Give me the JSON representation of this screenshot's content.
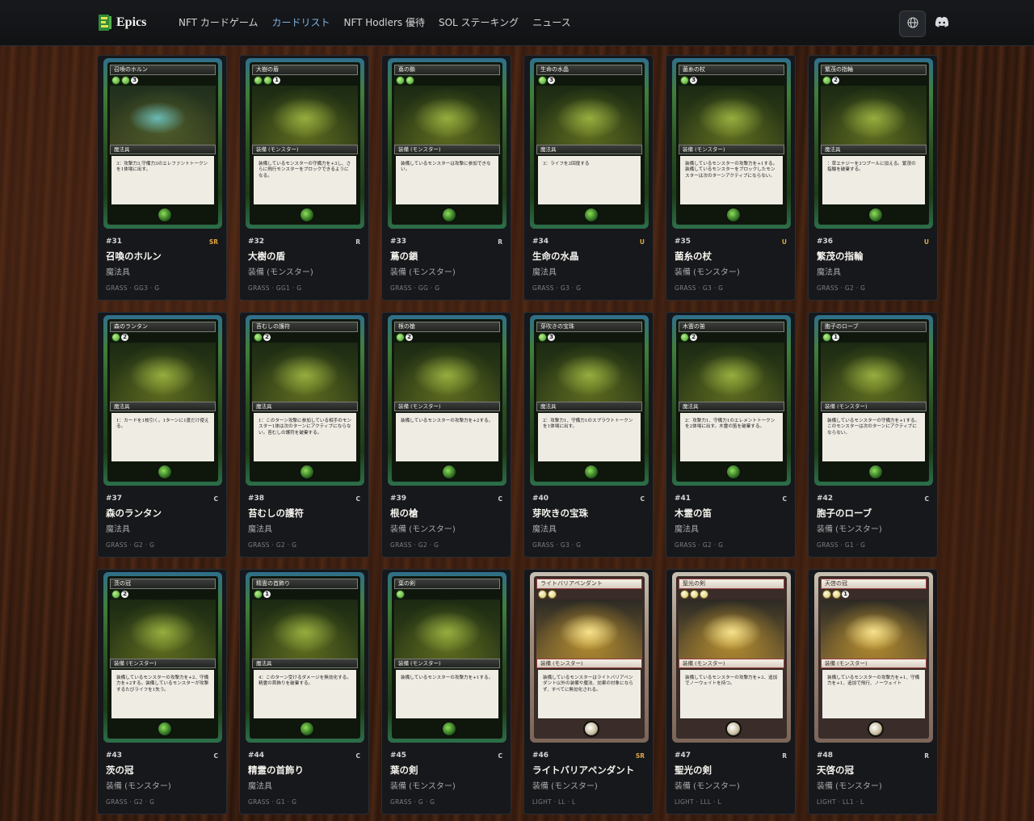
{
  "header": {
    "brand": "Epics",
    "nav": [
      {
        "label": "NFT カードゲーム",
        "active": false
      },
      {
        "label": "カードリスト",
        "active": true
      },
      {
        "label": "NFT Hodlers 優待",
        "active": false
      },
      {
        "label": "SOL ステーキング",
        "active": false
      },
      {
        "label": "ニュース",
        "active": false
      }
    ],
    "icons": {
      "language": "globe-icon",
      "discord": "discord-icon"
    }
  },
  "colors": {
    "accent": "#7fb3e6",
    "rarity_highlight": "#e0a640",
    "card_bg": "#16181b"
  },
  "cards": [
    {
      "number": "#31",
      "rarity": "SR",
      "name": "召喚のホルン",
      "type": "魔法具",
      "stats": "GRASS · GG3 · G",
      "art_title": "召喚のホルン",
      "art_type": "魔法具",
      "art_text": "3：攻撃力3,守備力3のエレファントトークンを1体場に出す。",
      "gems": 2,
      "cost": "3",
      "theme": "grass",
      "pic": "blue"
    },
    {
      "number": "#32",
      "rarity": "R",
      "name": "大樹の盾",
      "type": "装備 (モンスター)",
      "stats": "GRASS · GG1 · G",
      "art_title": "大樹の盾",
      "art_type": "装備 (モンスター)",
      "art_text": "装備しているモンスターの守備力を+3し、さらに飛行モンスターをブロックできるようになる。",
      "gems": 2,
      "cost": "1",
      "theme": "grass",
      "pic": "green"
    },
    {
      "number": "#33",
      "rarity": "R",
      "name": "蔦の鎖",
      "type": "装備 (モンスター)",
      "stats": "GRASS · GG · G",
      "art_title": "蔦の鎖",
      "art_type": "装備 (モンスター)",
      "art_text": "装備しているモンスターは攻撃に参加できない。",
      "gems": 2,
      "cost": "",
      "theme": "grass",
      "pic": "green"
    },
    {
      "number": "#34",
      "rarity": "U",
      "name": "生命の水晶",
      "type": "魔法具",
      "stats": "GRASS · G3 · G",
      "art_title": "生命の水晶",
      "art_type": "魔法具",
      "art_text": "3：ライフを2回復する",
      "gems": 1,
      "cost": "3",
      "theme": "grass",
      "pic": "green"
    },
    {
      "number": "#35",
      "rarity": "U",
      "name": "菌糸の杖",
      "type": "装備 (モンスター)",
      "stats": "GRASS · G3 · G",
      "art_title": "菌糸の杖",
      "art_type": "装備 (モンスター)",
      "art_text": "装備しているモンスターの攻撃力を+1する。装備しているモンスターをブロックしたモンスターは次のターンアクティブにならない。",
      "gems": 1,
      "cost": "3",
      "theme": "grass",
      "pic": "green"
    },
    {
      "number": "#36",
      "rarity": "U",
      "name": "繁茂の指輪",
      "type": "魔法具",
      "stats": "GRASS · G2 · G",
      "art_title": "繁茂の指輪",
      "art_type": "魔法具",
      "art_text": "：草エナジーを3つプールに加える。繁茂の指輪を破棄する。",
      "gems": 1,
      "cost": "2",
      "theme": "grass",
      "pic": "green"
    },
    {
      "number": "#37",
      "rarity": "C",
      "name": "森のランタン",
      "type": "魔法具",
      "stats": "GRASS · G2 · G",
      "art_title": "森のランタン",
      "art_type": "魔法具",
      "art_text": "1：カードを1枚引く。1ターンに1度だけ使える。",
      "gems": 1,
      "cost": "2",
      "theme": "grass",
      "pic": "green"
    },
    {
      "number": "#38",
      "rarity": "C",
      "name": "苔むしの護符",
      "type": "魔法具",
      "stats": "GRASS · G2 · G",
      "art_title": "苔むしの護符",
      "art_type": "魔法具",
      "art_text": "1：このターン攻撃に参加している相手のモンスター1体は次のターンにアクティブにならない。苔むしの護符を破棄する。",
      "gems": 1,
      "cost": "2",
      "theme": "grass",
      "pic": "green"
    },
    {
      "number": "#39",
      "rarity": "C",
      "name": "根の槍",
      "type": "装備 (モンスター)",
      "stats": "GRASS · G2 · G",
      "art_title": "根の槍",
      "art_type": "装備 (モンスター)",
      "art_text": "装備しているモンスターの攻撃力を+2する。",
      "gems": 1,
      "cost": "2",
      "theme": "grass",
      "pic": "green"
    },
    {
      "number": "#40",
      "rarity": "C",
      "name": "芽吹きの宝珠",
      "type": "魔法具",
      "stats": "GRASS · G3 · G",
      "art_title": "芽吹きの宝珠",
      "art_type": "魔法具",
      "art_text": "2：攻撃力1、守備力1のスプラウトトークンを1体場に出す。",
      "gems": 1,
      "cost": "3",
      "theme": "grass",
      "pic": "green"
    },
    {
      "number": "#41",
      "rarity": "C",
      "name": "木霊の笛",
      "type": "魔法具",
      "stats": "GRASS · G2 · G",
      "art_title": "木霊の笛",
      "art_type": "魔法具",
      "art_text": "2：攻撃力1、守備力1のエレメントトークンを2体場に出す。木霊の笛を破棄する。",
      "gems": 1,
      "cost": "2",
      "theme": "grass",
      "pic": "green"
    },
    {
      "number": "#42",
      "rarity": "C",
      "name": "胞子のローブ",
      "type": "装備 (モンスター)",
      "stats": "GRASS · G1 · G",
      "art_title": "胞子のローブ",
      "art_type": "装備 (モンスター)",
      "art_text": "装備しているモンスターの守備力を+1する。このモンスターは次のターンにアクティブにならない。",
      "gems": 1,
      "cost": "1",
      "theme": "grass",
      "pic": "green"
    },
    {
      "number": "#43",
      "rarity": "C",
      "name": "茨の冠",
      "type": "装備 (モンスター)",
      "stats": "GRASS · G2 · G",
      "art_title": "茨の冠",
      "art_type": "装備 (モンスター)",
      "art_text": "装備しているモンスターの攻撃力を+2、守備力を+2する。装備しているモンスターが攻撃するたびライフを1失う。",
      "gems": 1,
      "cost": "2",
      "theme": "grass",
      "pic": "green"
    },
    {
      "number": "#44",
      "rarity": "C",
      "name": "精霊の首飾り",
      "type": "魔法具",
      "stats": "GRASS · G1 · G",
      "art_title": "精霊の首飾り",
      "art_type": "魔法具",
      "art_text": "4：このターン受けるダメージを無効化する。精霊の首飾りを破棄する。",
      "gems": 1,
      "cost": "1",
      "theme": "grass",
      "pic": "green"
    },
    {
      "number": "#45",
      "rarity": "C",
      "name": "葉の剣",
      "type": "装備 (モンスター)",
      "stats": "GRASS · G · G",
      "art_title": "葉の剣",
      "art_type": "装備 (モンスター)",
      "art_text": "装備しているモンスターの攻撃力を+1する。",
      "gems": 1,
      "cost": "",
      "theme": "grass",
      "pic": "green"
    },
    {
      "number": "#46",
      "rarity": "SR",
      "name": "ライトバリアペンダント",
      "type": "装備 (モンスター)",
      "stats": "LIGHT · LL · L",
      "art_title": "ライトバリアペンダント",
      "art_type": "装備 (モンスター)",
      "art_text": "装備しているモンスターはライトバリアペンダント以外の装備や魔法、効果の対象にならず、すべてに無効化される。",
      "gems": 2,
      "cost": "",
      "theme": "light",
      "pic": "portal"
    },
    {
      "number": "#47",
      "rarity": "R",
      "name": "聖光の剣",
      "type": "装備 (モンスター)",
      "stats": "LIGHT · LLL · L",
      "art_title": "聖光の剣",
      "art_type": "装備 (モンスター)",
      "art_text": "装備しているモンスターの攻撃力を+3、追加でノーウェイトを持つ。",
      "gems": 3,
      "cost": "",
      "theme": "light",
      "pic": "gold"
    },
    {
      "number": "#48",
      "rarity": "R",
      "name": "天啓の冠",
      "type": "装備 (モンスター)",
      "stats": "LIGHT · LL1 · L",
      "art_title": "天啓の冠",
      "art_type": "装備 (モンスター)",
      "art_text": "装備しているモンスターの攻撃力を+1、守備力を+1、追加で飛行、ノーウェイト",
      "gems": 2,
      "cost": "1",
      "theme": "light",
      "pic": "gold"
    }
  ]
}
